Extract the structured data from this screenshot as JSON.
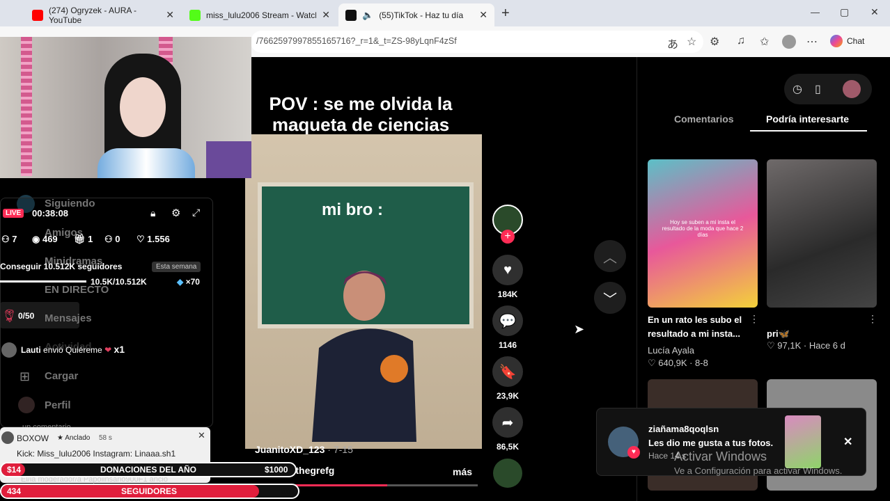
{
  "browser": {
    "tabs": [
      {
        "label": "(274) Ogryzek - AURA - YouTube",
        "close": "✕"
      },
      {
        "label": "miss_lulu2006 Stream - Watch Live",
        "close": "✕"
      },
      {
        "label": "(55)TikTok - Haz tu día",
        "close": "✕"
      }
    ],
    "new_tab": "+",
    "url": "/7662597997855165716?_r=1&_t=ZS-98yLqnF4zSf",
    "chat_label": "Chat",
    "window_controls": [
      "—",
      "▢",
      "✕"
    ]
  },
  "tiktok": {
    "caption_top": "POV : se me olvida la maqueta de ciencias naturales",
    "caption_overlay": "mi bro :",
    "author": "JuanitoXD_123",
    "date": "7-15",
    "hashtags": "#n       yp#thegrefg",
    "more": "más",
    "progress": 0.6,
    "likes": "184K",
    "comments": "1146",
    "saves": "23,9K",
    "shares": "86,5K",
    "tabs": {
      "comments": "Comentarios",
      "interest": "Podría interesarte"
    },
    "recommendations": [
      {
        "title": "En un rato les subo el resultado a mi insta...",
        "author": "Lucía Ayala",
        "likes": "640,9K",
        "date": "8-8",
        "overlay": "Hoy se suben a mi insta el resultado de la moda que hace 2 días"
      },
      {
        "title": "pri🦋",
        "likes": "97,1K",
        "date": "Hace 6 d"
      }
    ],
    "notification": {
      "user": "ziañama8qoqlsn",
      "text": "Les dio me gusta a tus fotos.",
      "time": "Hace 14 s",
      "close": "✕"
    },
    "watermark": {
      "line1": "Activar Windows",
      "line2": "Ve a Configuración para activar Windows."
    }
  },
  "sidenav": {
    "items": [
      "Siguiendo",
      "Amigos",
      "Minidramas",
      "EN DIRECTO",
      "Mensajes",
      "Actividad",
      "Cargar",
      "Perfil"
    ]
  },
  "stream_overlay": {
    "live_badge": "LIVE",
    "timer": "00:38:08",
    "stats": {
      "a": "7",
      "viewers": "469",
      "gifts": "1",
      "follows": "0",
      "likes": "1.556"
    },
    "goal_text": "Conseguir 10.512K seguidores",
    "goal_period": "Esta semana",
    "goal_progress": "10.5K/10.512K",
    "goal_reward": "×70",
    "gift_counter": "0/50",
    "gift_msg_user": "Lauti",
    "gift_msg_text": "envió Quiéreme",
    "gift_msg_count": "x1",
    "more_comments": "un comentario"
  },
  "chat": {
    "user": "BOXOW",
    "badge": "Anclado",
    "age": "58 s",
    "message": "Kick: Miss_lulu2006 Instagram: Linaaa.sh1",
    "mod_line": "El/la moderador/a Papolinsano900F1 anció",
    "close": "✕"
  },
  "bars": {
    "donations": {
      "amount": "$14",
      "label": "DONACIONES DEL AÑO",
      "goal": "$1000",
      "fill": 0.014
    },
    "followers": {
      "count": "434",
      "label": "SEGUIDORES",
      "goal": "500",
      "fill": 0.868
    }
  }
}
